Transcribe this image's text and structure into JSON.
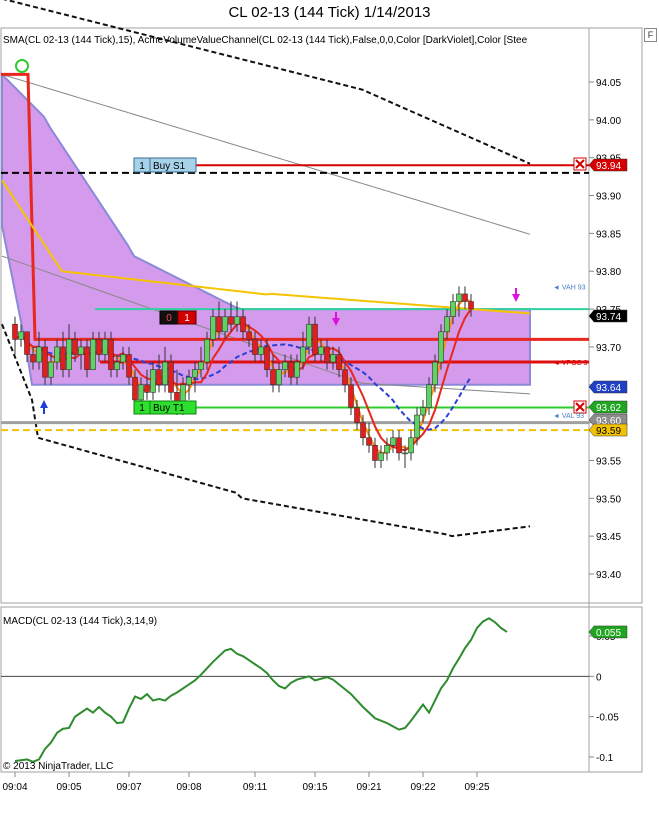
{
  "window": {
    "title": "CL 02-13 (144 Tick)  1/14/2013",
    "float_button": "F",
    "copyright": "© 2013 NinjaTrader, LLC"
  },
  "price_panel": {
    "indicator_text": "SMA(CL 02-13 (144 Tick),15), AcmeVolumeValueChannel(CL 02-13 (144 Tick),False,0,0,Color [DarkViolet],Color [Stee",
    "ylim": [
      93.35,
      94.1
    ],
    "y_ticks": [
      94.05,
      94.0,
      93.95,
      93.9,
      93.85,
      93.8,
      93.75,
      93.7,
      93.65,
      93.6,
      93.55,
      93.5,
      93.45,
      93.4
    ],
    "y_tick_labels": [
      "94.05",
      "94.00",
      "93.95",
      "93.90",
      "93.85",
      "93.80",
      "93.75",
      "93.70",
      "93.65",
      "93.60",
      "93.55",
      "93.50",
      "93.45",
      "93.40"
    ],
    "price_tags": [
      {
        "price": 93.94,
        "text": "93.94",
        "bg": "#d40000",
        "fg": "#ffffff"
      },
      {
        "price": 93.74,
        "text": "93.74",
        "bg": "#000000",
        "fg": "#ffffff"
      },
      {
        "price": 93.64,
        "text": "93.64",
        "bg": "#1f3fc4",
        "fg": "#ffffff"
      },
      {
        "price": 93.62,
        "text": "93.62",
        "bg": "#1fa51f",
        "fg": "#ffffff"
      },
      {
        "price": 93.6,
        "text": "93.60",
        "bg": "#8c8c8c",
        "fg": "#ffffff"
      },
      {
        "price": 93.59,
        "text": "93.59",
        "bg": "#f2c200",
        "fg": "#000000"
      }
    ],
    "level_labels": [
      {
        "text": "◄ VAH 93",
        "price": 93.78,
        "color": "#4a7fc4"
      },
      {
        "text": "◄ VPOC 9",
        "price": 93.68,
        "color": "#d40000"
      },
      {
        "text": "◄ VAL 93",
        "price": 93.61,
        "color": "#4a7fc4"
      }
    ],
    "orders": {
      "buy_s1": {
        "label": "Buy S1",
        "qty": "1",
        "price": 93.94
      },
      "buy_t1": {
        "label": "Buy T1",
        "qty": "1",
        "price": 93.62
      },
      "position": {
        "left": "0",
        "right": "1",
        "price": 93.74
      }
    }
  },
  "macd_panel": {
    "label": "MACD(CL 02-13 (144 Tick),3,14,9)",
    "ylim": [
      -0.115,
      0.085
    ],
    "y_ticks": [
      0.05,
      0.0,
      -0.05,
      -0.1
    ],
    "y_tick_labels": [
      "0.05",
      "0",
      "-0.05",
      "-0.1"
    ],
    "current_tag": {
      "value": 0.055,
      "text": "0.055",
      "bg": "#1fa51f",
      "fg": "#ffffff"
    }
  },
  "x_axis": {
    "labels": [
      "09:04",
      "09:05",
      "09:07",
      "09:08",
      "09:11",
      "09:15",
      "09:21",
      "09:22",
      "09:25"
    ],
    "label_bar_index": [
      0,
      9,
      19,
      29,
      40,
      50,
      59,
      68,
      77
    ]
  },
  "chart_data": {
    "type": "candlestick",
    "n_bars": 86,
    "bars": [
      {
        "o": 93.73,
        "h": 93.74,
        "l": 93.69,
        "c": 93.71
      },
      {
        "o": 93.71,
        "h": 93.73,
        "l": 93.7,
        "c": 93.72
      },
      {
        "o": 93.72,
        "h": 93.72,
        "l": 93.68,
        "c": 93.69
      },
      {
        "o": 93.69,
        "h": 93.7,
        "l": 93.67,
        "c": 93.68
      },
      {
        "o": 93.68,
        "h": 93.72,
        "l": 93.67,
        "c": 93.7
      },
      {
        "o": 93.7,
        "h": 93.71,
        "l": 93.65,
        "c": 93.66
      },
      {
        "o": 93.66,
        "h": 93.69,
        "l": 93.65,
        "c": 93.68
      },
      {
        "o": 93.68,
        "h": 93.71,
        "l": 93.67,
        "c": 93.7
      },
      {
        "o": 93.7,
        "h": 93.72,
        "l": 93.66,
        "c": 93.67
      },
      {
        "o": 93.67,
        "h": 93.73,
        "l": 93.66,
        "c": 93.71
      },
      {
        "o": 93.71,
        "h": 93.72,
        "l": 93.68,
        "c": 93.69
      },
      {
        "o": 93.69,
        "h": 93.71,
        "l": 93.67,
        "c": 93.7
      },
      {
        "o": 93.7,
        "h": 93.71,
        "l": 93.66,
        "c": 93.67
      },
      {
        "o": 93.67,
        "h": 93.72,
        "l": 93.67,
        "c": 93.71
      },
      {
        "o": 93.71,
        "h": 93.72,
        "l": 93.68,
        "c": 93.69
      },
      {
        "o": 93.69,
        "h": 93.72,
        "l": 93.68,
        "c": 93.71
      },
      {
        "o": 93.71,
        "h": 93.72,
        "l": 93.66,
        "c": 93.67
      },
      {
        "o": 93.67,
        "h": 93.69,
        "l": 93.66,
        "c": 93.68
      },
      {
        "o": 93.68,
        "h": 93.7,
        "l": 93.67,
        "c": 93.69
      },
      {
        "o": 93.69,
        "h": 93.7,
        "l": 93.65,
        "c": 93.66
      },
      {
        "o": 93.66,
        "h": 93.67,
        "l": 93.62,
        "c": 93.63
      },
      {
        "o": 93.63,
        "h": 93.66,
        "l": 93.62,
        "c": 93.65
      },
      {
        "o": 93.65,
        "h": 93.67,
        "l": 93.63,
        "c": 93.64
      },
      {
        "o": 93.64,
        "h": 93.68,
        "l": 93.63,
        "c": 93.67
      },
      {
        "o": 93.67,
        "h": 93.69,
        "l": 93.64,
        "c": 93.65
      },
      {
        "o": 93.65,
        "h": 93.7,
        "l": 93.64,
        "c": 93.68
      },
      {
        "o": 93.68,
        "h": 93.69,
        "l": 93.63,
        "c": 93.64
      },
      {
        "o": 93.64,
        "h": 93.67,
        "l": 93.61,
        "c": 93.62
      },
      {
        "o": 93.62,
        "h": 93.66,
        "l": 93.61,
        "c": 93.65
      },
      {
        "o": 93.65,
        "h": 93.67,
        "l": 93.63,
        "c": 93.66
      },
      {
        "o": 93.66,
        "h": 93.68,
        "l": 93.64,
        "c": 93.67
      },
      {
        "o": 93.67,
        "h": 93.7,
        "l": 93.66,
        "c": 93.68
      },
      {
        "o": 93.68,
        "h": 93.72,
        "l": 93.67,
        "c": 93.71
      },
      {
        "o": 93.71,
        "h": 93.75,
        "l": 93.7,
        "c": 93.74
      },
      {
        "o": 93.74,
        "h": 93.76,
        "l": 93.71,
        "c": 93.72
      },
      {
        "o": 93.72,
        "h": 93.75,
        "l": 93.71,
        "c": 93.74
      },
      {
        "o": 93.74,
        "h": 93.76,
        "l": 93.72,
        "c": 93.73
      },
      {
        "o": 93.73,
        "h": 93.76,
        "l": 93.72,
        "c": 93.74
      },
      {
        "o": 93.74,
        "h": 93.75,
        "l": 93.71,
        "c": 93.72
      },
      {
        "o": 93.72,
        "h": 93.73,
        "l": 93.7,
        "c": 93.71
      },
      {
        "o": 93.71,
        "h": 93.72,
        "l": 93.68,
        "c": 93.69
      },
      {
        "o": 93.69,
        "h": 93.71,
        "l": 93.68,
        "c": 93.7
      },
      {
        "o": 93.7,
        "h": 93.71,
        "l": 93.66,
        "c": 93.67
      },
      {
        "o": 93.67,
        "h": 93.69,
        "l": 93.64,
        "c": 93.65
      },
      {
        "o": 93.65,
        "h": 93.68,
        "l": 93.64,
        "c": 93.67
      },
      {
        "o": 93.67,
        "h": 93.69,
        "l": 93.66,
        "c": 93.68
      },
      {
        "o": 93.68,
        "h": 93.69,
        "l": 93.65,
        "c": 93.66
      },
      {
        "o": 93.66,
        "h": 93.69,
        "l": 93.65,
        "c": 93.68
      },
      {
        "o": 93.68,
        "h": 93.72,
        "l": 93.67,
        "c": 93.7
      },
      {
        "o": 93.7,
        "h": 93.74,
        "l": 93.69,
        "c": 93.73
      },
      {
        "o": 93.73,
        "h": 93.74,
        "l": 93.68,
        "c": 93.69
      },
      {
        "o": 93.69,
        "h": 93.71,
        "l": 93.68,
        "c": 93.7
      },
      {
        "o": 93.7,
        "h": 93.71,
        "l": 93.67,
        "c": 93.68
      },
      {
        "o": 93.68,
        "h": 93.7,
        "l": 93.67,
        "c": 93.69
      },
      {
        "o": 93.69,
        "h": 93.7,
        "l": 93.66,
        "c": 93.67
      },
      {
        "o": 93.67,
        "h": 93.68,
        "l": 93.64,
        "c": 93.65
      },
      {
        "o": 93.65,
        "h": 93.66,
        "l": 93.61,
        "c": 93.62
      },
      {
        "o": 93.62,
        "h": 93.63,
        "l": 93.59,
        "c": 93.6
      },
      {
        "o": 93.6,
        "h": 93.61,
        "l": 93.57,
        "c": 93.58
      },
      {
        "o": 93.58,
        "h": 93.6,
        "l": 93.56,
        "c": 93.57
      },
      {
        "o": 93.57,
        "h": 93.58,
        "l": 93.54,
        "c": 93.55
      },
      {
        "o": 93.55,
        "h": 93.57,
        "l": 93.54,
        "c": 93.56
      },
      {
        "o": 93.56,
        "h": 93.58,
        "l": 93.55,
        "c": 93.57
      },
      {
        "o": 93.57,
        "h": 93.59,
        "l": 93.56,
        "c": 93.58
      },
      {
        "o": 93.58,
        "h": 93.59,
        "l": 93.55,
        "c": 93.56
      },
      {
        "o": 93.56,
        "h": 93.57,
        "l": 93.54,
        "c": 93.56
      },
      {
        "o": 93.56,
        "h": 93.59,
        "l": 93.55,
        "c": 93.58
      },
      {
        "o": 93.58,
        "h": 93.62,
        "l": 93.57,
        "c": 93.61
      },
      {
        "o": 93.61,
        "h": 93.63,
        "l": 93.6,
        "c": 93.62
      },
      {
        "o": 93.62,
        "h": 93.66,
        "l": 93.61,
        "c": 93.65
      },
      {
        "o": 93.65,
        "h": 93.69,
        "l": 93.64,
        "c": 93.68
      },
      {
        "o": 93.68,
        "h": 93.73,
        "l": 93.67,
        "c": 93.72
      },
      {
        "o": 93.72,
        "h": 93.75,
        "l": 93.71,
        "c": 93.74
      },
      {
        "o": 93.74,
        "h": 93.77,
        "l": 93.73,
        "c": 93.76
      },
      {
        "o": 93.76,
        "h": 93.78,
        "l": 93.74,
        "c": 93.77
      },
      {
        "o": 93.77,
        "h": 93.78,
        "l": 93.75,
        "c": 93.76
      },
      {
        "o": 93.76,
        "h": 93.77,
        "l": 93.74,
        "c": 93.75
      }
    ],
    "series": [
      {
        "name": "SMA(15)",
        "color": "#e8271f",
        "values": []
      },
      {
        "name": "",
        "color": "#ff8c1a",
        "values": []
      },
      {
        "name": "",
        "color": "#2a3fd6",
        "values": []
      }
    ],
    "horizontal_levels": [
      {
        "price": 93.94,
        "color": "#d40000",
        "style": "solid",
        "label": "Buy S1"
      },
      {
        "price": 93.93,
        "color": "#000000",
        "style": "dashed"
      },
      {
        "price": 93.75,
        "color": "#30d0a0",
        "style": "solid"
      },
      {
        "price": 93.68,
        "color": "#e01010",
        "style": "solid"
      },
      {
        "price": 93.62,
        "color": "#2ecc2e",
        "style": "solid",
        "label": "Buy T1"
      },
      {
        "price": 93.6,
        "color": "#a0a0a0",
        "style": "solid"
      },
      {
        "price": 93.59,
        "color": "#f2c200",
        "style": "dashed"
      }
    ],
    "macd": [
      -0.105,
      -0.104,
      -0.103,
      -0.106,
      -0.103,
      -0.09,
      -0.082,
      -0.07,
      -0.065,
      -0.064,
      -0.05,
      -0.045,
      -0.04,
      -0.045,
      -0.038,
      -0.045,
      -0.05,
      -0.058,
      -0.057,
      -0.04,
      -0.025,
      -0.028,
      -0.022,
      -0.03,
      -0.028,
      -0.03,
      -0.024,
      -0.02,
      -0.015,
      -0.01,
      -0.005,
      0.002,
      0.01,
      0.018,
      0.025,
      0.032,
      0.034,
      0.028,
      0.025,
      0.02,
      0.015,
      0.01,
      0.004,
      -0.005,
      -0.012,
      -0.015,
      -0.008,
      -0.004,
      -0.002,
      0.0,
      -0.005,
      -0.003,
      -0.001,
      -0.004,
      -0.01,
      -0.016,
      -0.022,
      -0.03,
      -0.038,
      -0.045,
      -0.052,
      -0.055,
      -0.058,
      -0.062,
      -0.066,
      -0.064,
      -0.055,
      -0.045,
      -0.035,
      -0.045,
      -0.03,
      -0.015,
      -0.005,
      0.01,
      0.022,
      0.035,
      0.045,
      0.06,
      0.068,
      0.072,
      0.067,
      0.06,
      0.055
    ],
    "y_range_price": [
      93.35,
      94.1
    ],
    "y_range_macd": [
      -0.115,
      0.085
    ]
  }
}
